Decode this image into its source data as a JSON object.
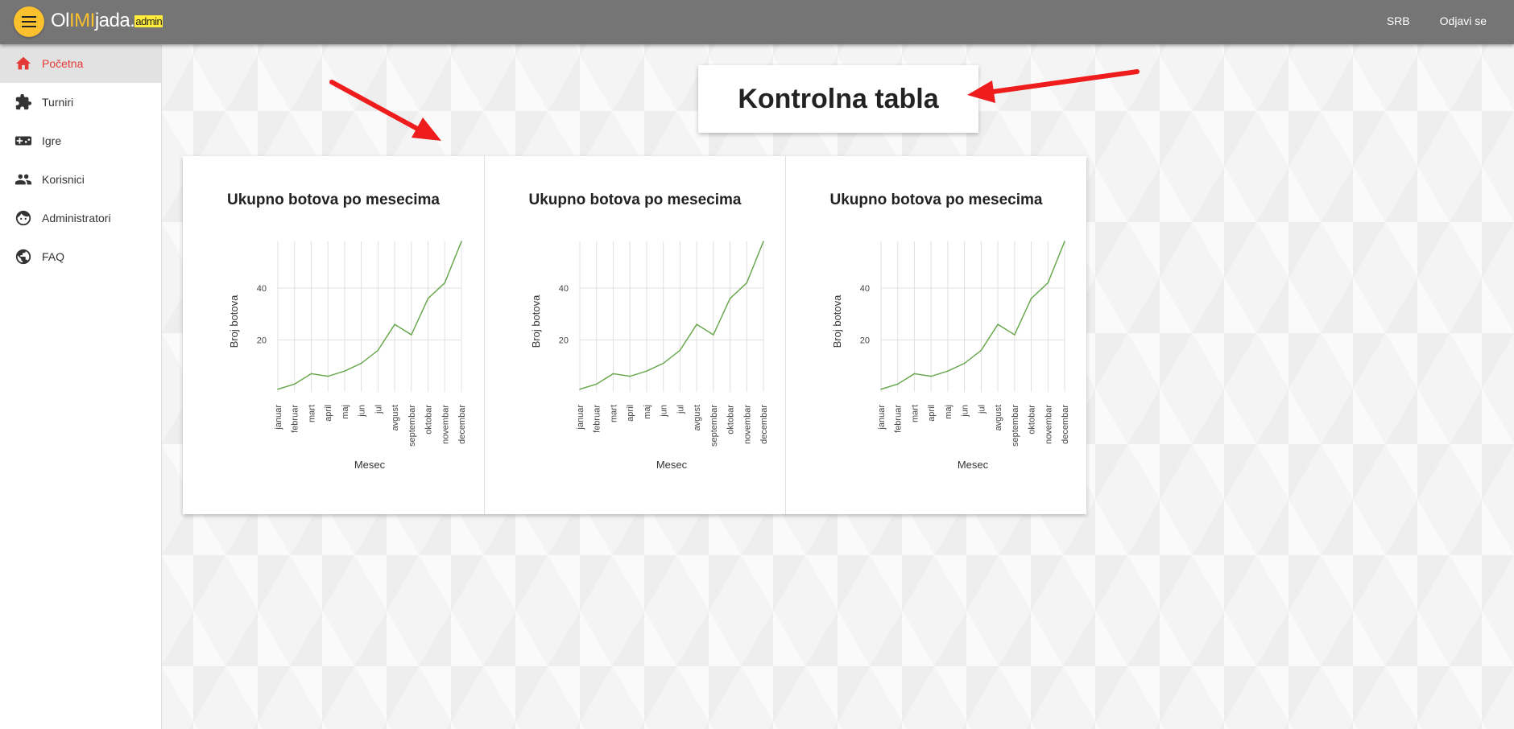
{
  "header": {
    "logo_ol": "Ol",
    "logo_imi": "IMI",
    "logo_jada": "jada.",
    "logo_tag": "admin",
    "lang": "SRB",
    "logout": "Odjavi se"
  },
  "sidebar": {
    "items": [
      {
        "label": "Početna",
        "icon": "home-icon",
        "active": true
      },
      {
        "label": "Turniri",
        "icon": "puzzle-icon"
      },
      {
        "label": "Igre",
        "icon": "gamepad-icon"
      },
      {
        "label": "Korisnici",
        "icon": "people-icon"
      },
      {
        "label": "Administratori",
        "icon": "face-icon"
      },
      {
        "label": "FAQ",
        "icon": "globe-icon"
      }
    ]
  },
  "page_title": "Kontrolna tabla",
  "colors": {
    "accent": "#fbc02d",
    "active": "#e53935",
    "line": "#6aa84f",
    "topbar": "#757575",
    "annotation_arrow": "#ee1c1c"
  },
  "chart_data": [
    {
      "type": "line",
      "title": "Ukupno botova po mesecima",
      "xlabel": "Mesec",
      "ylabel": "Broj botova",
      "categories": [
        "januar",
        "februar",
        "mart",
        "april",
        "maj",
        "jun",
        "jul",
        "avgust",
        "septembar",
        "oktobar",
        "novembar",
        "decembar"
      ],
      "series": [
        {
          "values": [
            1,
            3,
            7,
            6,
            8,
            11,
            16,
            26,
            22,
            36,
            42,
            58
          ]
        }
      ],
      "yticks": [
        20,
        40
      ],
      "ylim": [
        0,
        58
      ],
      "grid": true
    },
    {
      "type": "line",
      "title": "Ukupno botova po mesecima",
      "xlabel": "Mesec",
      "ylabel": "Broj botova",
      "categories": [
        "januar",
        "februar",
        "mart",
        "april",
        "maj",
        "jun",
        "jul",
        "avgust",
        "septembar",
        "oktobar",
        "novembar",
        "decembar"
      ],
      "series": [
        {
          "values": [
            1,
            3,
            7,
            6,
            8,
            11,
            16,
            26,
            22,
            36,
            42,
            58
          ]
        }
      ],
      "yticks": [
        20,
        40
      ],
      "ylim": [
        0,
        58
      ],
      "grid": true
    },
    {
      "type": "line",
      "title": "Ukupno botova po mesecima",
      "xlabel": "Mesec",
      "ylabel": "Broj botova",
      "categories": [
        "januar",
        "februar",
        "mart",
        "april",
        "maj",
        "jun",
        "jul",
        "avgust",
        "septembar",
        "oktobar",
        "novembar",
        "decembar"
      ],
      "series": [
        {
          "values": [
            1,
            3,
            7,
            6,
            8,
            11,
            16,
            26,
            22,
            36,
            42,
            58
          ]
        }
      ],
      "yticks": [
        20,
        40
      ],
      "ylim": [
        0,
        58
      ],
      "grid": true
    }
  ]
}
